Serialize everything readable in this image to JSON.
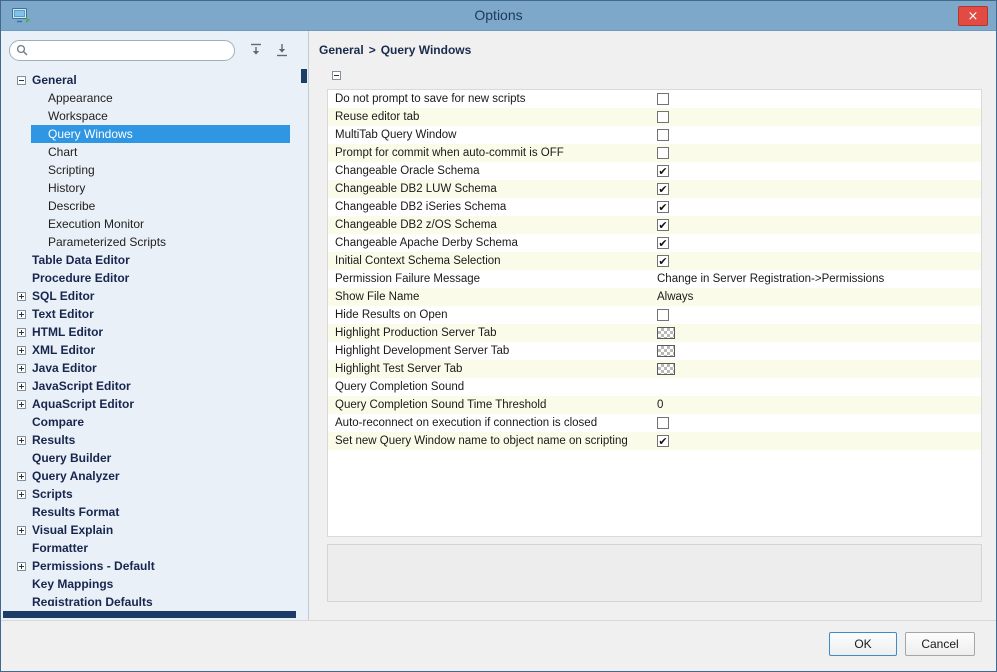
{
  "window": {
    "title": "Options",
    "close_glyph": "×"
  },
  "colors": {
    "titlebar": "#7ea8ca",
    "selection_blue": "#2e96e3",
    "close_red": "#e14b44",
    "row_alt": "#fbfbe9",
    "sidebar_bg": "#eaf0f7"
  },
  "icons": {
    "app": "app-icon",
    "search": "magnifier",
    "expand_all": "expand-all",
    "collapse_all": "collapse-all",
    "close": "x",
    "check": "check-mark"
  },
  "sidebar": {
    "search": {
      "value": "",
      "placeholder": ""
    },
    "tree": [
      {
        "label": "General",
        "level": 0,
        "expander": "minus",
        "bold": true,
        "selected": false
      },
      {
        "label": "Appearance",
        "level": 1,
        "expander": "none",
        "bold": false,
        "selected": false
      },
      {
        "label": "Workspace",
        "level": 1,
        "expander": "none",
        "bold": false,
        "selected": false
      },
      {
        "label": "Query Windows",
        "level": 1,
        "expander": "none",
        "bold": false,
        "selected": true
      },
      {
        "label": "Chart",
        "level": 1,
        "expander": "none",
        "bold": false,
        "selected": false
      },
      {
        "label": "Scripting",
        "level": 1,
        "expander": "none",
        "bold": false,
        "selected": false
      },
      {
        "label": "History",
        "level": 1,
        "expander": "none",
        "bold": false,
        "selected": false
      },
      {
        "label": "Describe",
        "level": 1,
        "expander": "none",
        "bold": false,
        "selected": false
      },
      {
        "label": "Execution Monitor",
        "level": 1,
        "expander": "none",
        "bold": false,
        "selected": false
      },
      {
        "label": "Parameterized Scripts",
        "level": 1,
        "expander": "none",
        "bold": false,
        "selected": false
      },
      {
        "label": "Table Data Editor",
        "level": 0,
        "expander": "none",
        "bold": true,
        "selected": false
      },
      {
        "label": "Procedure Editor",
        "level": 0,
        "expander": "none",
        "bold": true,
        "selected": false
      },
      {
        "label": "SQL Editor",
        "level": 0,
        "expander": "plus",
        "bold": true,
        "selected": false
      },
      {
        "label": "Text Editor",
        "level": 0,
        "expander": "plus",
        "bold": true,
        "selected": false
      },
      {
        "label": "HTML Editor",
        "level": 0,
        "expander": "plus",
        "bold": true,
        "selected": false
      },
      {
        "label": "XML Editor",
        "level": 0,
        "expander": "plus",
        "bold": true,
        "selected": false
      },
      {
        "label": "Java Editor",
        "level": 0,
        "expander": "plus",
        "bold": true,
        "selected": false
      },
      {
        "label": "JavaScript Editor",
        "level": 0,
        "expander": "plus",
        "bold": true,
        "selected": false
      },
      {
        "label": "AquaScript Editor",
        "level": 0,
        "expander": "plus",
        "bold": true,
        "selected": false
      },
      {
        "label": "Compare",
        "level": 0,
        "expander": "none",
        "bold": true,
        "selected": false
      },
      {
        "label": "Results",
        "level": 0,
        "expander": "plus",
        "bold": true,
        "selected": false
      },
      {
        "label": "Query Builder",
        "level": 0,
        "expander": "none",
        "bold": true,
        "selected": false
      },
      {
        "label": "Query Analyzer",
        "level": 0,
        "expander": "plus",
        "bold": true,
        "selected": false
      },
      {
        "label": "Scripts",
        "level": 0,
        "expander": "plus",
        "bold": true,
        "selected": false
      },
      {
        "label": "Results Format",
        "level": 0,
        "expander": "none",
        "bold": true,
        "selected": false
      },
      {
        "label": "Visual Explain",
        "level": 0,
        "expander": "plus",
        "bold": true,
        "selected": false
      },
      {
        "label": "Formatter",
        "level": 0,
        "expander": "none",
        "bold": true,
        "selected": false
      },
      {
        "label": "Permissions - Default",
        "level": 0,
        "expander": "plus",
        "bold": true,
        "selected": false
      },
      {
        "label": "Key Mappings",
        "level": 0,
        "expander": "none",
        "bold": true,
        "selected": false
      },
      {
        "label": "Registration Defaults",
        "level": 0,
        "expander": "none",
        "bold": true,
        "selected": false
      }
    ]
  },
  "breadcrumb": {
    "parts": [
      "General",
      "Query Windows"
    ],
    "separator": ">"
  },
  "settings": {
    "check_glyph": "✔",
    "rows": [
      {
        "label": "Do not prompt to save for new scripts",
        "type": "checkbox",
        "checked": false
      },
      {
        "label": "Reuse editor tab",
        "type": "checkbox",
        "checked": false
      },
      {
        "label": "MultiTab Query Window",
        "type": "checkbox",
        "checked": false
      },
      {
        "label": "Prompt for commit when auto-commit is OFF",
        "type": "checkbox",
        "checked": false
      },
      {
        "label": "Changeable Oracle Schema",
        "type": "checkbox",
        "checked": true
      },
      {
        "label": "Changeable DB2 LUW Schema",
        "type": "checkbox",
        "checked": true
      },
      {
        "label": "Changeable DB2 iSeries Schema",
        "type": "checkbox",
        "checked": true
      },
      {
        "label": "Changeable DB2 z/OS Schema",
        "type": "checkbox",
        "checked": true
      },
      {
        "label": "Changeable Apache Derby Schema",
        "type": "checkbox",
        "checked": true
      },
      {
        "label": "Initial Context Schema Selection",
        "type": "checkbox",
        "checked": true
      },
      {
        "label": "Permission Failure Message",
        "type": "text",
        "value": "Change in Server Registration->Permissions"
      },
      {
        "label": "Show File Name",
        "type": "text",
        "value": "Always"
      },
      {
        "label": "Hide Results on Open",
        "type": "checkbox",
        "checked": false
      },
      {
        "label": "Highlight Production Server Tab",
        "type": "color",
        "value": "transparent-checker"
      },
      {
        "label": "Highlight Development Server Tab",
        "type": "color",
        "value": "transparent-checker"
      },
      {
        "label": "Highlight Test Server Tab",
        "type": "color",
        "value": "transparent-checker"
      },
      {
        "label": "Query Completion Sound",
        "type": "text",
        "value": ""
      },
      {
        "label": "Query Completion Sound Time Threshold",
        "type": "text",
        "value": "0"
      },
      {
        "label": "Auto-reconnect on execution if connection is closed",
        "type": "checkbox",
        "checked": false
      },
      {
        "label": "Set new Query Window name to object name on scripting",
        "type": "checkbox",
        "checked": true
      }
    ]
  },
  "footer": {
    "ok": "OK",
    "cancel": "Cancel"
  }
}
